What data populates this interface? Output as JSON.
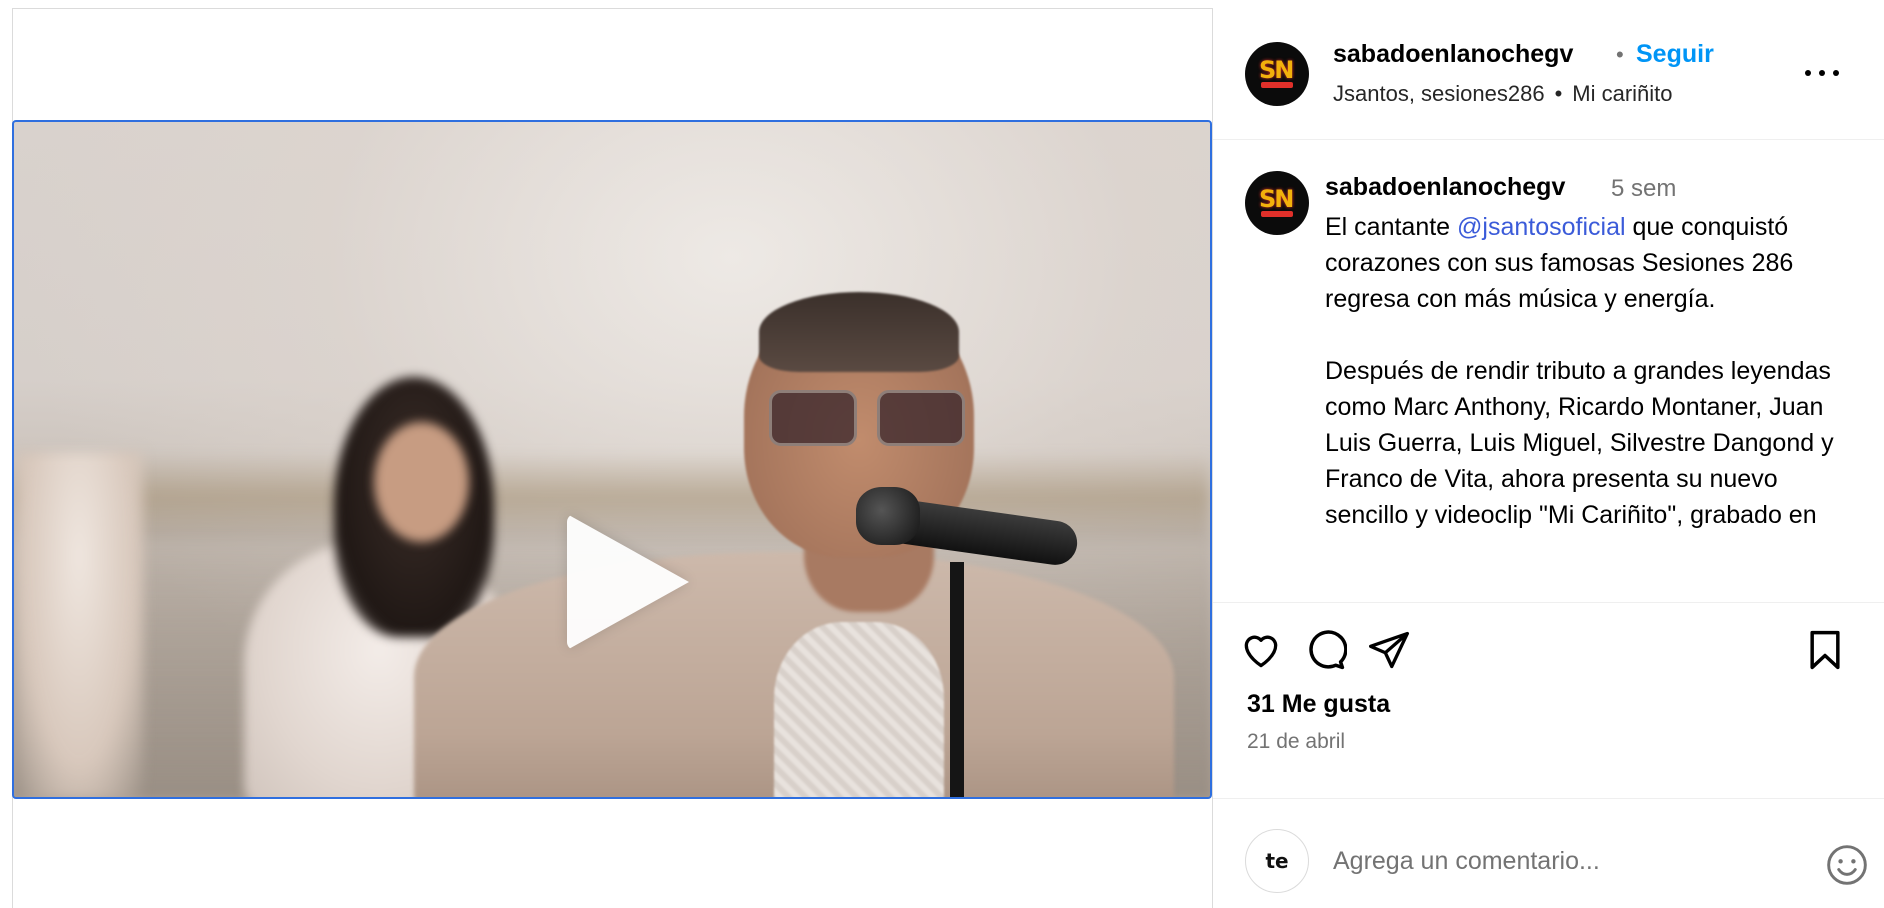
{
  "post": {
    "username": "sabadoenlanochegv",
    "follow_label": "Seguir",
    "dot": "•",
    "subtitle_accounts": "Jsantos, sesiones286",
    "subtitle_sep": "•",
    "subtitle_song": "Mi cariñito",
    "more_icon": "more-horizontal-icon"
  },
  "media": {
    "play_icon": "play-icon",
    "mute_icon": "speaker-muted-icon"
  },
  "caption": {
    "username": "sabadoenlanochegv",
    "time": "5 sem",
    "text_before_mention": "El cantante ",
    "mention": "@jsantosoficial",
    "text_after_mention": " que conquistó corazones con sus famosas Sesiones 286 regresa con más música y energía.",
    "paragraph2": "Después de rendir tributo a grandes leyendas como Marc Anthony, Ricardo Montaner, Juan Luis Guerra, Luis Miguel, Silvestre Dangond y Franco de Vita, ahora presenta su nuevo sencillo y videoclip \"Mi Cariñito\", grabado en"
  },
  "actions": {
    "icons": [
      "heart-icon",
      "comment-icon",
      "share-icon",
      "bookmark-icon"
    ],
    "likes": "31 Me gusta",
    "date": "21 de abril"
  },
  "comment": {
    "placeholder": "Agrega un comentario...",
    "avatar_text": "te",
    "emoji_icon": "emoji-icon"
  },
  "colors": {
    "follow": "#0095f6",
    "mention": "#3b5bd9",
    "secondary_text": "#737373",
    "border": "#dbdbdb"
  }
}
